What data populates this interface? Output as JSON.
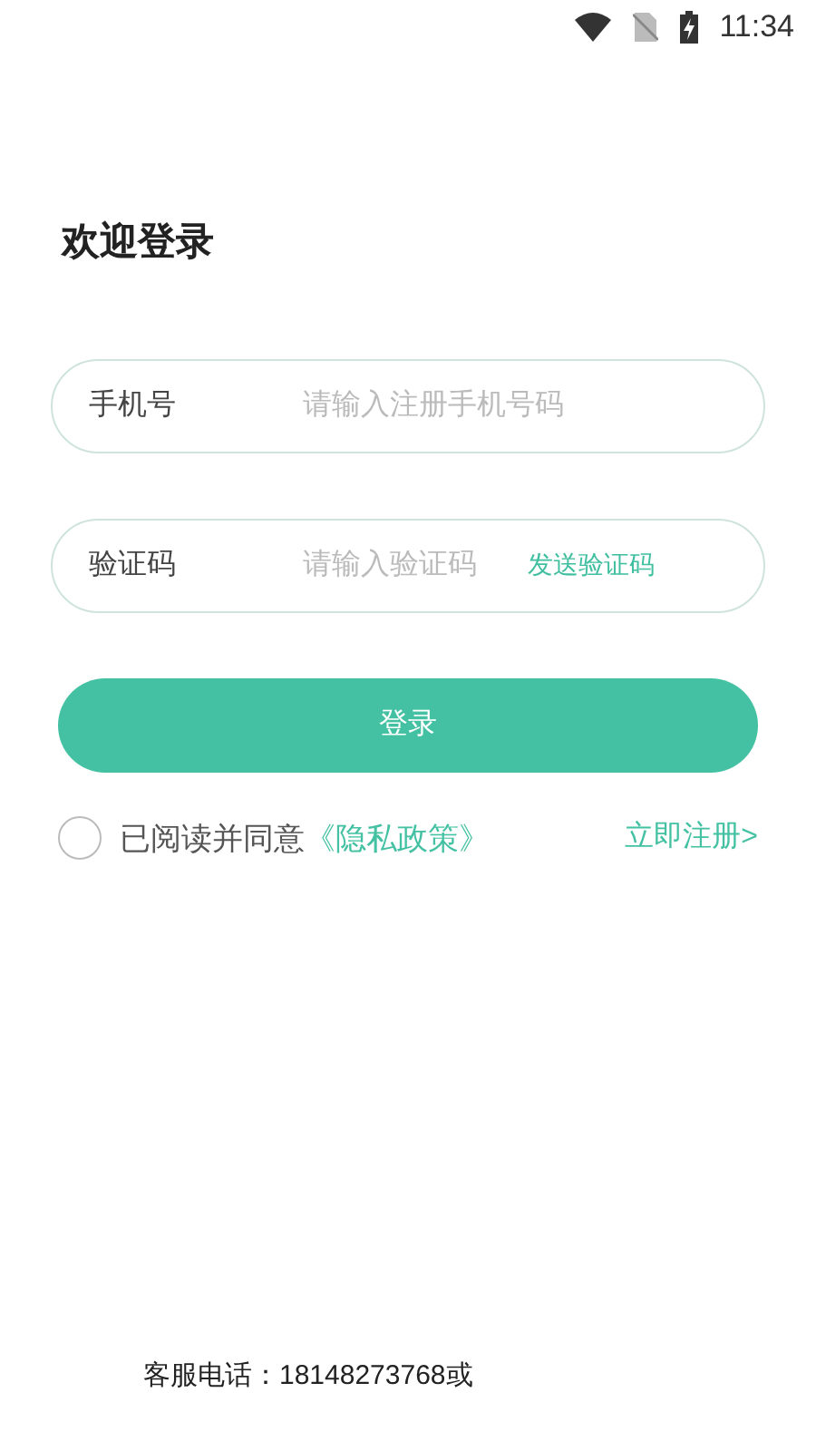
{
  "status_bar": {
    "time": "11:34"
  },
  "title": "欢迎登录",
  "fields": [
    {
      "label": "手机号",
      "placeholder": "请输入注册手机号码"
    },
    {
      "label": "验证码",
      "placeholder": "请输入验证码",
      "action": "发送验证码"
    }
  ],
  "login_button": "登录",
  "agreement": {
    "checked": false,
    "text": "已阅读并同意",
    "link": "《隐私政策》"
  },
  "register_link": "立即注册>",
  "footer": "客服电话：18148273768或"
}
